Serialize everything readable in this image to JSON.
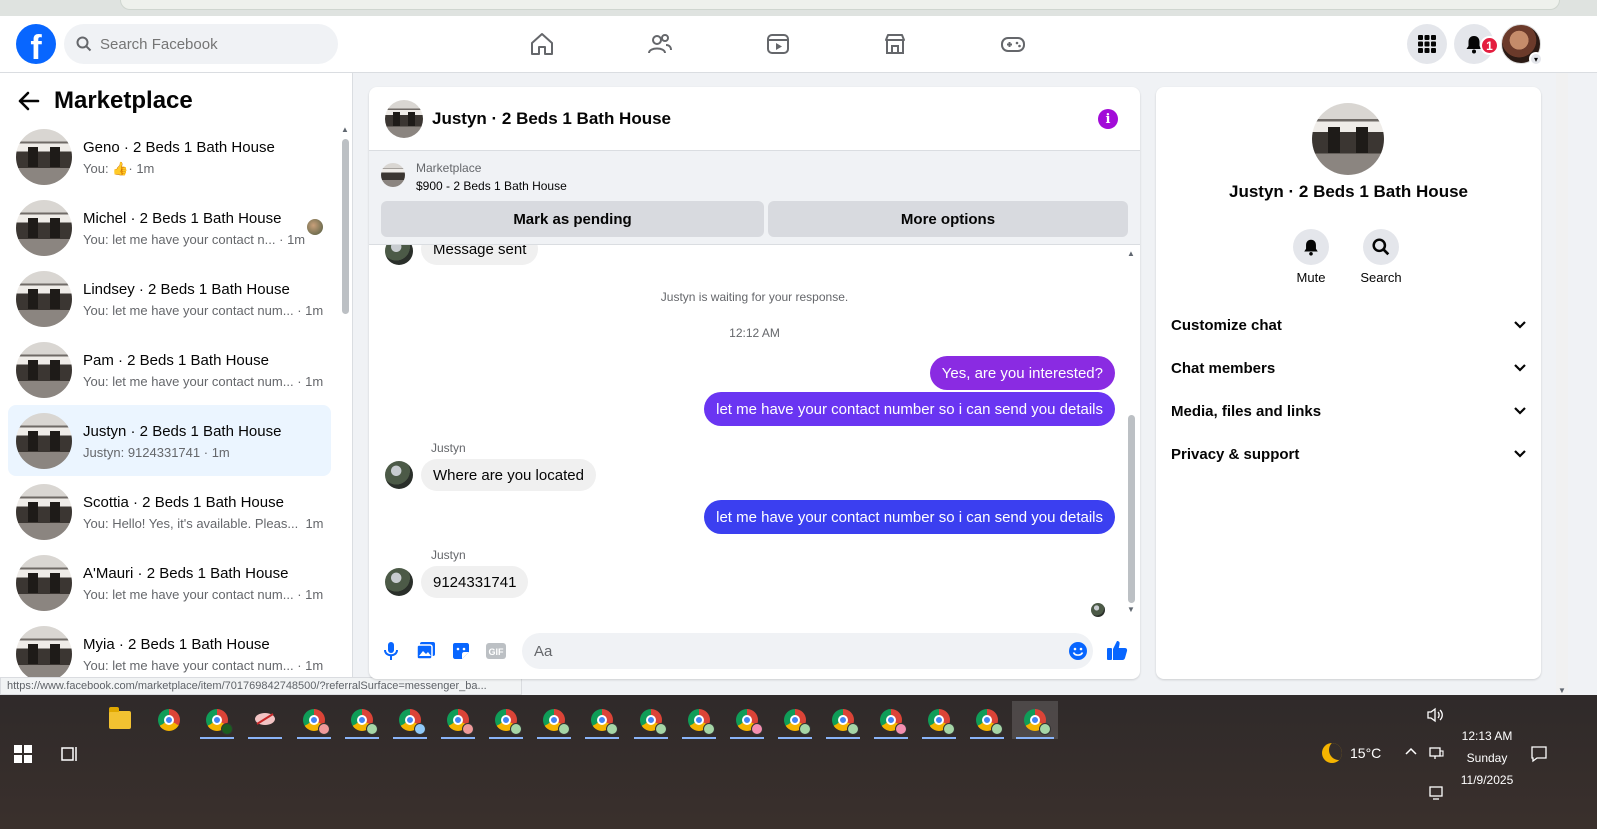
{
  "header": {
    "logo": "f",
    "search_placeholder": "Search Facebook",
    "nav_icons": [
      "home-icon",
      "friends-icon",
      "video-icon",
      "marketplace-icon",
      "gaming-icon"
    ],
    "notification_count": "1",
    "colors": {
      "brand": "#0866ff",
      "badge": "#e41e3f"
    }
  },
  "sidebar": {
    "title": "Marketplace",
    "conversations": [
      {
        "name": "Geno · 2 Beds 1 Bath House",
        "preview_prefix": "You:",
        "preview": "",
        "time": "· 1m",
        "has_like": true
      },
      {
        "name": "Michel · 2 Beds 1 Bath House",
        "preview_prefix": "You:",
        "preview": "let me have your contact n...",
        "time": "· 1m",
        "seen": true
      },
      {
        "name": "Lindsey · 2 Beds 1 Bath House",
        "preview_prefix": "You:",
        "preview": "let me have your contact num...",
        "time": "· 1m"
      },
      {
        "name": "Pam · 2 Beds 1 Bath House",
        "preview_prefix": "You:",
        "preview": "let me have your contact num...",
        "time": "· 1m"
      },
      {
        "name": "Justyn · 2 Beds 1 Bath House",
        "preview_prefix": "Justyn:",
        "preview": "9124331741",
        "time": "· 1m",
        "active": true
      },
      {
        "name": "Scottia · 2 Beds 1 Bath House",
        "preview_prefix": "You:",
        "preview": "Hello! Yes, it's available. Pleas...",
        "time": "1m"
      },
      {
        "name": "A'Mauri · 2 Beds 1 Bath House",
        "preview_prefix": "You:",
        "preview": "let me have your contact num...",
        "time": "· 1m"
      },
      {
        "name": "Myia · 2 Beds 1 Bath House",
        "preview_prefix": "You:",
        "preview": "let me have your contact num...",
        "time": "· 1m"
      }
    ]
  },
  "status_url": "https://www.facebook.com/marketplace/item/701769842748500/?referralSurface=messenger_ba...",
  "chat": {
    "title": "Justyn · 2 Beds 1 Bath House",
    "listing_category": "Marketplace",
    "listing_name": "$900 - 2 Beds 1 Bath House",
    "mark_pending": "Mark as pending",
    "more_options": "More options",
    "message_sent": "Message sent",
    "waiting_note": "Justyn is waiting for your response.",
    "timestamp": "12:12 AM",
    "out_1": "Yes, are you interested?",
    "out_2": "let me have your contact number so i can send you details",
    "in_sender_1": "Justyn",
    "in_1": "Where are you located",
    "out_3": "let me have your contact number so i can send you details",
    "in_sender_2": "Justyn",
    "in_2": "9124331741",
    "composer_placeholder": "Aa",
    "colors": {
      "out_purple": "#8a2be2",
      "out_violet": "#6a35f2",
      "out_blue": "#3b3ff0",
      "info": "#a20bd8"
    }
  },
  "right_panel": {
    "title": "Justyn · 2 Beds 1 Bath House",
    "mute": "Mute",
    "search": "Search",
    "sections": [
      "Customize chat",
      "Chat members",
      "Media, files and links",
      "Privacy & support"
    ]
  },
  "taskbar": {
    "weather": "15°C",
    "time": "12:13 AM",
    "day": "Sunday",
    "date": "11/9/2025"
  }
}
